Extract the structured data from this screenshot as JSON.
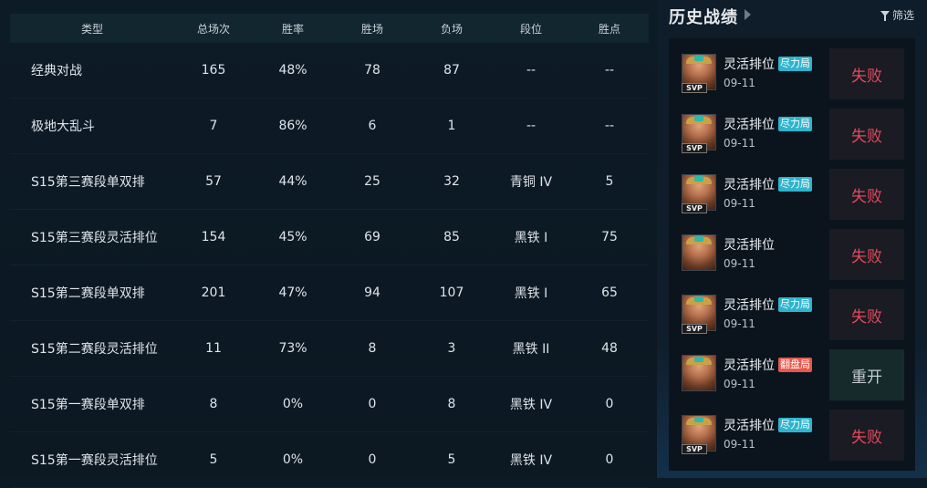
{
  "table": {
    "headers": [
      "类型",
      "总场次",
      "胜率",
      "胜场",
      "负场",
      "段位",
      "胜点"
    ],
    "rows": [
      [
        "经典对战",
        "165",
        "48%",
        "78",
        "87",
        "--",
        "--"
      ],
      [
        "极地大乱斗",
        "7",
        "86%",
        "6",
        "1",
        "--",
        "--"
      ],
      [
        "S15第三赛段单双排",
        "57",
        "44%",
        "25",
        "32",
        "青铜 IV",
        "5"
      ],
      [
        "S15第三赛段灵活排位",
        "154",
        "45%",
        "69",
        "85",
        "黑铁 I",
        "75"
      ],
      [
        "S15第二赛段单双排",
        "201",
        "47%",
        "94",
        "107",
        "黑铁 I",
        "65"
      ],
      [
        "S15第二赛段灵活排位",
        "11",
        "73%",
        "8",
        "3",
        "黑铁 II",
        "48"
      ],
      [
        "S15第一赛段单双排",
        "8",
        "0%",
        "0",
        "8",
        "黑铁 IV",
        "0"
      ],
      [
        "S15第一赛段灵活排位",
        "5",
        "0%",
        "0",
        "5",
        "黑铁 IV",
        "0"
      ]
    ]
  },
  "history": {
    "title": "历史战绩",
    "filter_label": "筛选",
    "matches": [
      {
        "mode": "灵活排位",
        "badge": "尽力局",
        "badge_color": "blue",
        "svp": "SVP",
        "date": "09-11",
        "result": "失败",
        "result_type": "lose"
      },
      {
        "mode": "灵活排位",
        "badge": "尽力局",
        "badge_color": "blue",
        "svp": "SVP",
        "date": "09-11",
        "result": "失败",
        "result_type": "lose"
      },
      {
        "mode": "灵活排位",
        "badge": "尽力局",
        "badge_color": "blue",
        "svp": "SVP",
        "date": "09-11",
        "result": "失败",
        "result_type": "lose"
      },
      {
        "mode": "灵活排位",
        "badge": "",
        "badge_color": "",
        "svp": "",
        "date": "09-11",
        "result": "失败",
        "result_type": "lose"
      },
      {
        "mode": "灵活排位",
        "badge": "尽力局",
        "badge_color": "blue",
        "svp": "SVP",
        "date": "09-11",
        "result": "失败",
        "result_type": "lose"
      },
      {
        "mode": "灵活排位",
        "badge": "翻盘局",
        "badge_color": "red",
        "svp": "",
        "date": "09-11",
        "result": "重开",
        "result_type": "remake"
      },
      {
        "mode": "灵活排位",
        "badge": "尽力局",
        "badge_color": "blue",
        "svp": "SVP",
        "date": "09-11",
        "result": "失败",
        "result_type": "lose"
      }
    ]
  },
  "colors": {
    "lose": "#e24a5c",
    "badge_blue": "#2fb4cd",
    "badge_red": "#e9574b"
  }
}
